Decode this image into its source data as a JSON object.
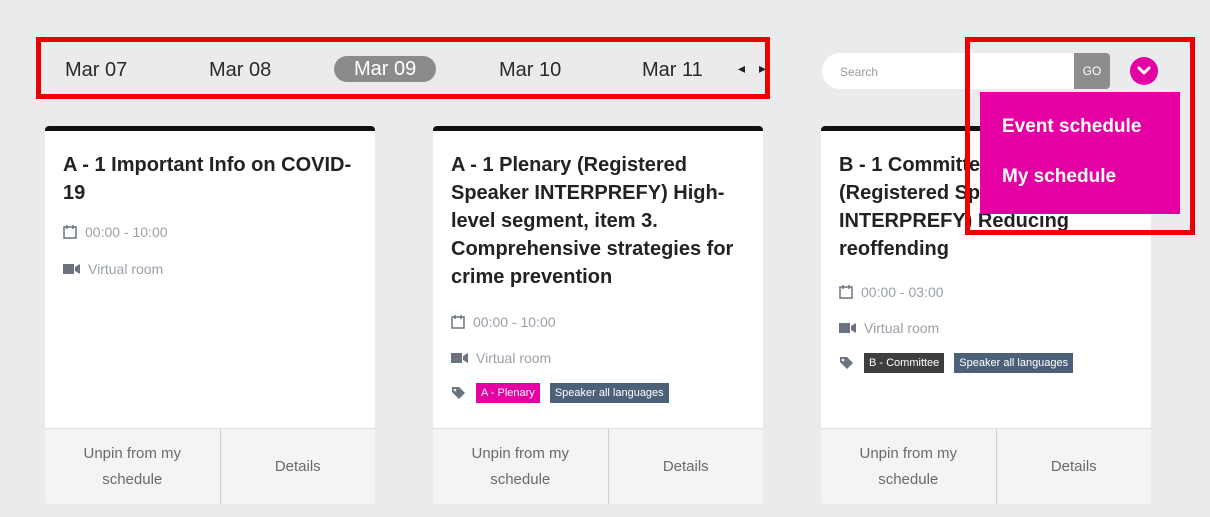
{
  "dates": {
    "items": [
      "Mar 07",
      "Mar 08",
      "Mar 09",
      "Mar 10",
      "Mar 11"
    ],
    "active_index": 2,
    "prev_arrow": "◂",
    "next_arrow": "▸"
  },
  "search": {
    "placeholder": "Search",
    "go_label": "GO"
  },
  "menu": {
    "items": [
      "Event schedule",
      "My schedule"
    ]
  },
  "cards": [
    {
      "title": "A - 1 Important Info on COVID-19",
      "time": "00:00 - 10:00",
      "location": "Virtual room",
      "tags": [],
      "unpin_label": "Unpin from my schedule",
      "details_label": "Details"
    },
    {
      "title": "A - 1 Plenary (Registered Speaker INTERPREFY) High-level segment, item 3. Comprehensive strategies for crime prevention",
      "time": "00:00 - 10:00",
      "location": "Virtual room",
      "tags": [
        "A - Plenary",
        "Speaker all languages"
      ],
      "unpin_label": "Unpin from my schedule",
      "details_label": "Details"
    },
    {
      "title": "B - 1 Committee Workshop I (Registered Speaker INTERPREFY) Reducing reoffending",
      "time": "00:00 - 03:00",
      "location": "Virtual room",
      "tags": [
        "B - Committee",
        "Speaker all languages"
      ],
      "unpin_label": "Unpin from my schedule",
      "details_label": "Details"
    }
  ],
  "colors": {
    "accent": "#e400a2",
    "highlight": "#ee0000",
    "active_date": "#8b8b8b",
    "tag_slate": "#4d607a",
    "tag_dark": "#3e3e3e"
  }
}
